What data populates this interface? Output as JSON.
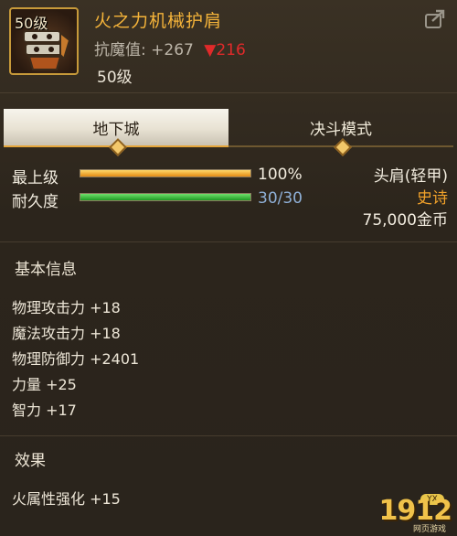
{
  "item": {
    "icon_level": "50级",
    "name": "火之力机械护肩",
    "resist_label": "抗魔值:",
    "resist_value": "+267",
    "resist_change": "▼216",
    "level": "50级"
  },
  "tabs": [
    {
      "label": "地下城",
      "active": true
    },
    {
      "label": "决斗模式",
      "active": false
    }
  ],
  "bars": {
    "max_label": "最上级",
    "max_value": "100%",
    "max_fraction": 1.0,
    "durability_label": "耐久度",
    "durability_value": "30/30",
    "durability_fraction": 1.0
  },
  "info": {
    "type": "头肩(轻甲)",
    "rarity": "史诗",
    "price": "75,000金币"
  },
  "basic": {
    "title": "基本信息",
    "stats": [
      "物理攻击力 +18",
      "魔法攻击力 +18",
      "物理防御力 +2401",
      "力量 +25",
      "智力 +17"
    ]
  },
  "effects": {
    "title": "效果",
    "items": [
      "火属性强化 +15"
    ]
  },
  "watermark": {
    "text": "1912",
    "badge": "YX",
    "sub": "网页游戏"
  },
  "colors": {
    "accent": "#f5b43a",
    "rarity": "#f2a22a",
    "decrease": "#e02a2a",
    "durability_text": "#8fb0d7"
  },
  "icons": [
    "share-icon",
    "shoulder-armor-icon"
  ]
}
